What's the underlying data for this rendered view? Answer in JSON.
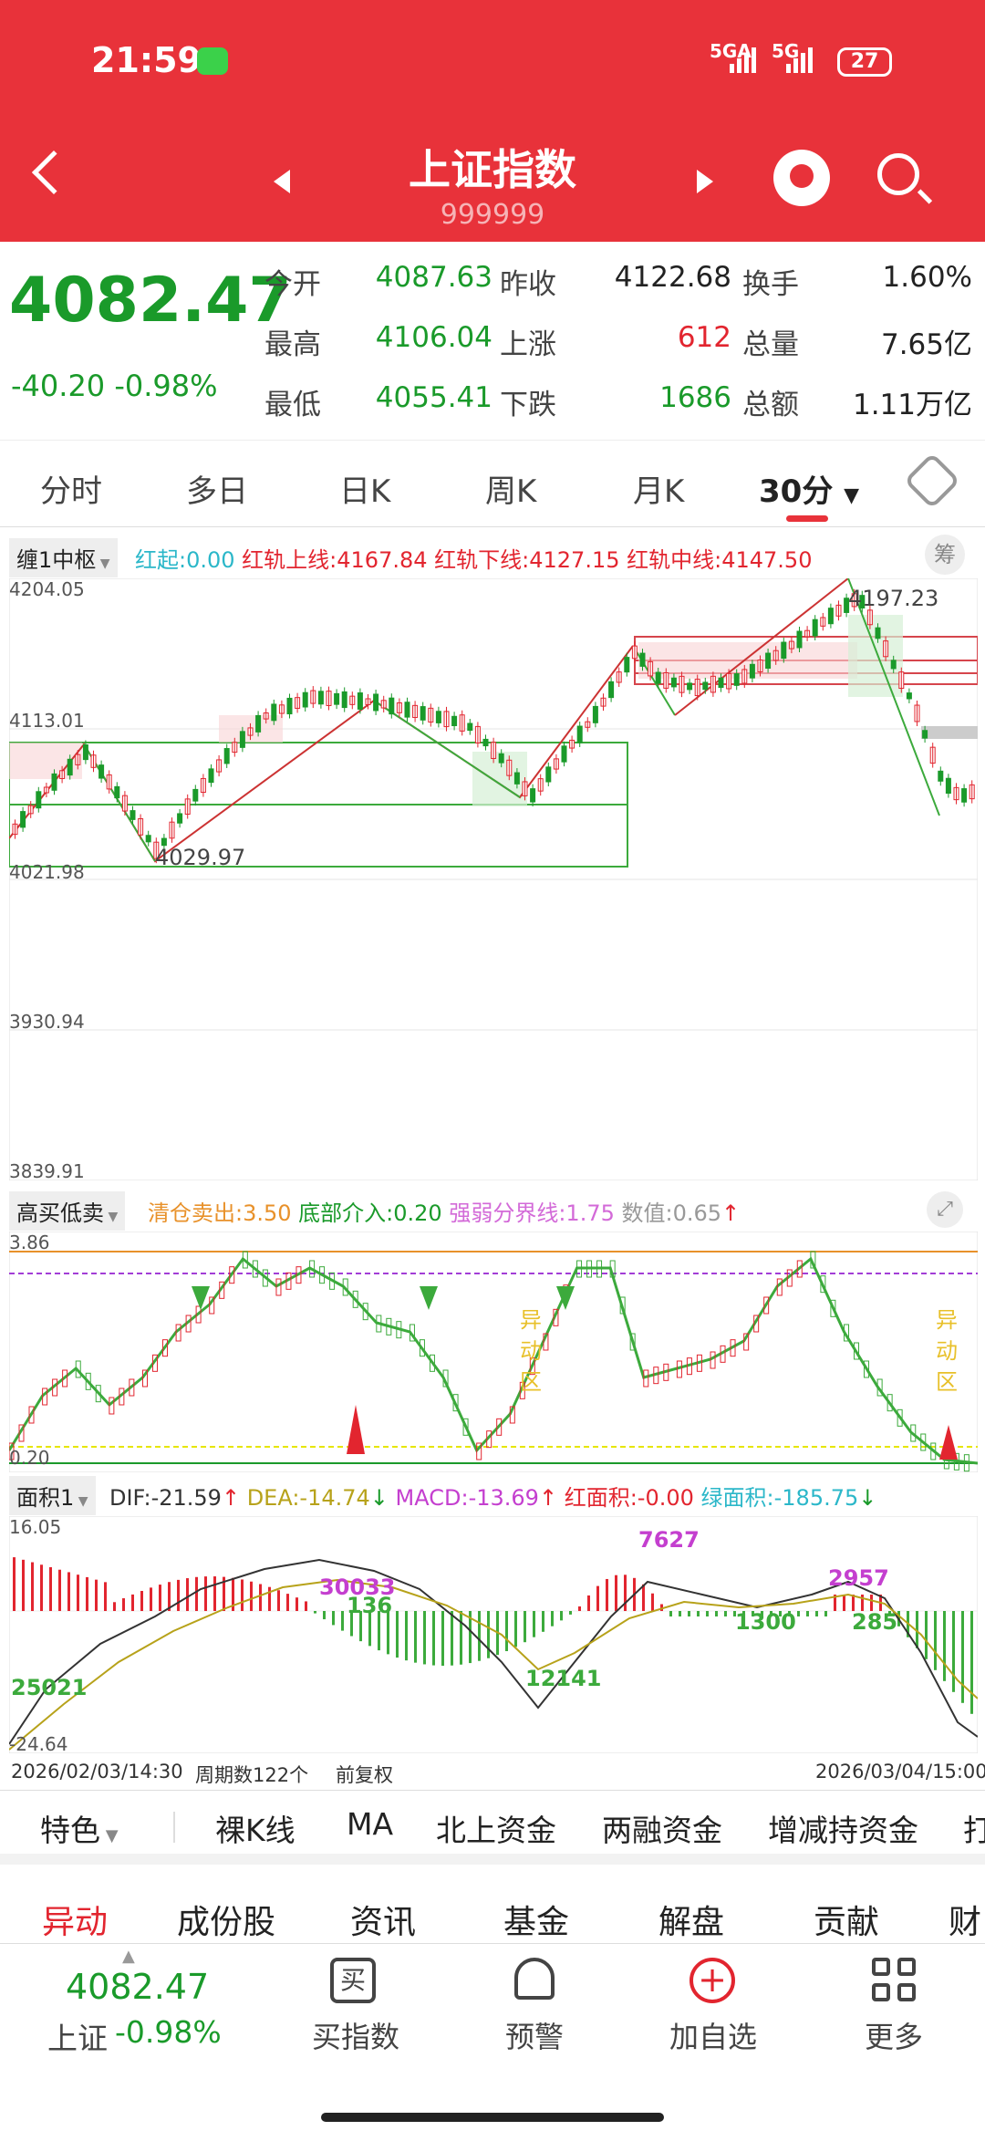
{
  "status": {
    "time": "21:59",
    "network1": "5GA",
    "network2": "5G",
    "battery": "27"
  },
  "header": {
    "title": "上证指数",
    "code": "999999"
  },
  "quote": {
    "price": "4082.47",
    "change": "-40.20 -0.98%",
    "rows": [
      {
        "l1": "今开",
        "v1": "4087.63",
        "l2": "昨收",
        "v2": "4122.68",
        "l3": "换手",
        "v3": "1.60%"
      },
      {
        "l1": "最高",
        "v1": "4106.04",
        "l2": "上涨",
        "v2": "612",
        "l3": "总量",
        "v3": "7.65亿"
      },
      {
        "l1": "最低",
        "v1": "4055.41",
        "l2": "下跌",
        "v2": "1686",
        "l3": "总额",
        "v3": "1.11万亿"
      }
    ]
  },
  "tabs": [
    "分时",
    "多日",
    "日K",
    "周K",
    "月K",
    "30分"
  ],
  "main_chart": {
    "indicator": "缠1中枢",
    "legend": [
      {
        "text": "红起:0.00",
        "color": "#2bb7c9"
      },
      {
        "text": "红轨上线:4167.84",
        "color": "#e2252f"
      },
      {
        "text": "红轨下线:4127.15",
        "color": "#e2252f"
      },
      {
        "text": "红轨中线:4147.50",
        "color": "#e2252f"
      }
    ],
    "chip_button": "筹",
    "y_ticks": [
      "4204.05",
      "4113.01",
      "4021.98",
      "3930.94",
      "3839.91"
    ],
    "annotations": [
      "4197.23",
      "4029.97"
    ]
  },
  "sub_chart1": {
    "indicator": "高买低卖",
    "legend": [
      {
        "text": "清仓卖出:3.50",
        "color": "#e8912a"
      },
      {
        "text": "底部介入:0.20",
        "color": "#1a9a2a"
      },
      {
        "text": "强弱分界线:1.75",
        "color": "#d36ad8"
      },
      {
        "text": "数值:0.65",
        "color": "#999999"
      }
    ],
    "y_top": "3.86",
    "y_bottom": "0.20",
    "zone_label": "异动区"
  },
  "sub_chart2": {
    "indicator": "面积1",
    "legend": [
      {
        "text": "DIF:-21.59",
        "color": "#333333"
      },
      {
        "text": "DEA:-14.74",
        "color": "#b7a21a"
      },
      {
        "text": "MACD:-13.69",
        "color": "#c43fcf"
      },
      {
        "text": "红面积:-0.00",
        "color": "#e2252f"
      },
      {
        "text": "绿面积:-185.75",
        "color": "#2bb7c9"
      }
    ],
    "y_top": "16.05",
    "y_bottom": "-24.64",
    "annotations": [
      "30033",
      "136",
      "12141",
      "25021",
      "7627",
      "1300",
      "2957",
      "285"
    ]
  },
  "time_axis": {
    "start": "2026/02/03/14:30",
    "count": "周期数122个",
    "adjust": "前复权",
    "end": "2026/03/04/15:00"
  },
  "indicator_bar": [
    "特色",
    "裸K线",
    "MA",
    "北上资金",
    "两融资金",
    "增减持资金",
    "打"
  ],
  "section_tabs": [
    "异动",
    "成份股",
    "资讯",
    "基金",
    "解盘",
    "贡献",
    "财"
  ],
  "footer": {
    "price": "4082.47",
    "name": "上证",
    "pct": "-0.98%",
    "buttons": [
      {
        "icon": "buy-icon",
        "label": "买指数",
        "glyph": "买"
      },
      {
        "icon": "bell-icon",
        "label": "预警"
      },
      {
        "icon": "add-icon",
        "label": "加自选"
      },
      {
        "icon": "grid-icon",
        "label": "更多"
      }
    ]
  },
  "colors": {
    "brand": "#e8323a",
    "up": "#e2252f",
    "down": "#1a9a2a"
  }
}
